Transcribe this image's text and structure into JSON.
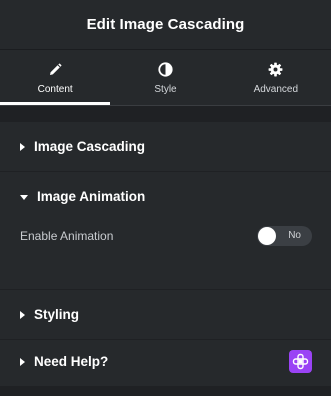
{
  "header": {
    "title": "Edit Image Cascading"
  },
  "tabs": [
    {
      "label": "Content",
      "icon": "pencil-icon",
      "active": true
    },
    {
      "label": "Style",
      "icon": "half-circle-icon",
      "active": false
    },
    {
      "label": "Advanced",
      "icon": "gear-icon",
      "active": false
    }
  ],
  "sections": {
    "image_cascading": {
      "title": "Image Cascading",
      "expanded": false
    },
    "image_animation": {
      "title": "Image Animation",
      "expanded": true,
      "controls": {
        "enable_animation": {
          "label": "Enable Animation",
          "state_text": "No",
          "enabled": false
        }
      }
    },
    "styling": {
      "title": "Styling",
      "expanded": false
    },
    "need_help": {
      "title": "Need Help?",
      "expanded": false,
      "icon": "help-plugin-icon"
    }
  },
  "colors": {
    "panel": "#26292c",
    "background": "#1f2124",
    "accent_purple": "#9a43f5",
    "text": "#ffffff"
  }
}
